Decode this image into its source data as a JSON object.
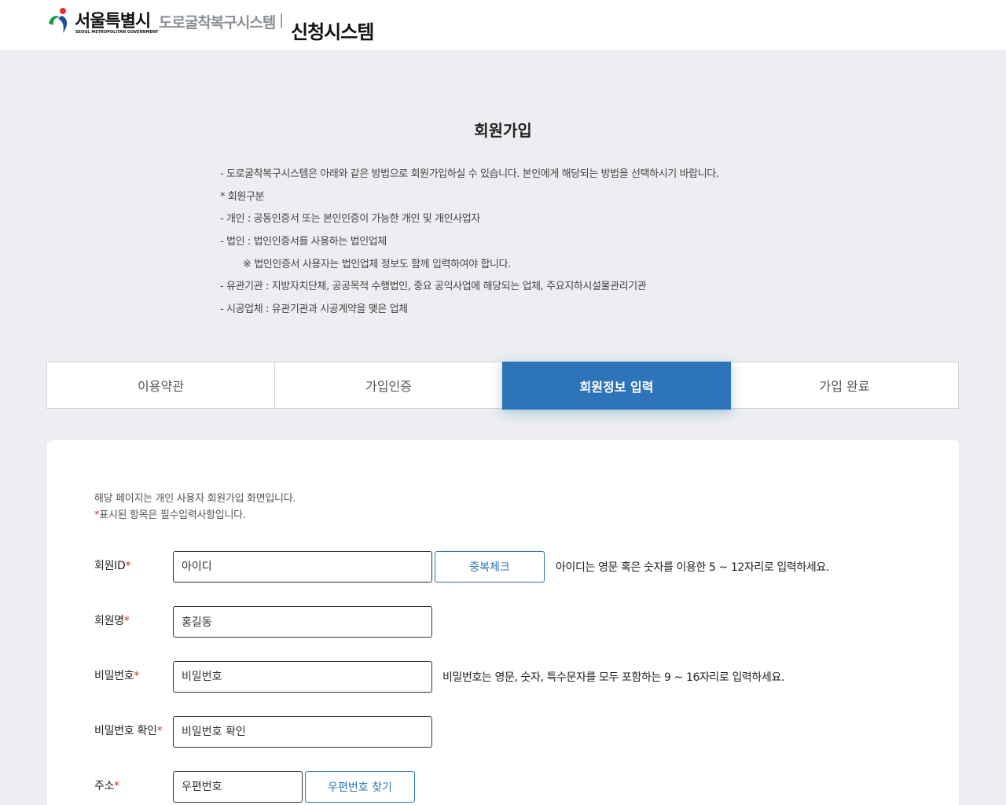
{
  "header": {
    "logo_text": "서울특별시",
    "logo_subtext": "SEOUL METROPOLITAN GOVERNMENT",
    "system_name": "도로굴착복구시스템",
    "separator": "|",
    "app_title": "신청시스템"
  },
  "page": {
    "title": "회원가입",
    "notices": [
      "- 도로굴착복구시스템은 아래와 같은 방법으로 회원가입하실 수 있습니다. 본인에게 해당되는 방법을 선택하시기 바랍니다.",
      "* 회원구분",
      "- 개인 : 공동인증서 또는 본인인증이 가능한 개인 및 개인사업자",
      "- 법인 : 법인인증서를 사용하는 법인업체",
      "※ 법인인증서 사용자는 법인업체 정보도 함께 입력하여야 합니다.",
      "- 유관기관 : 지방자치단체, 공공목적 수행법인, 중요 공익사업에 해당되는 업체, 주요지하시설물관리기관",
      "- 시공업체 : 유관기관과 시공계약을 맺은 업체"
    ]
  },
  "steps": [
    {
      "label": "이용약관"
    },
    {
      "label": "가입인증"
    },
    {
      "label": "회원정보 입력"
    },
    {
      "label": "가입 완료"
    }
  ],
  "form": {
    "guide_line1": "해당 페이지는 개인 사용자 회원가입 화면입니다.",
    "guide_required_mark": "*",
    "guide_line2": "표시된 항목은 필수입력사항입니다.",
    "required_mark": "*",
    "member_id": {
      "label": "회원ID",
      "placeholder": "아이디",
      "check_button": "중복체크",
      "hint": "아이디는 영문 혹은 숫자를 이용한 5 ~ 12자리로 입력하세요."
    },
    "member_name": {
      "label": "회원명",
      "value": "홍길동"
    },
    "password": {
      "label": "비밀번호",
      "placeholder": "비밀번호",
      "hint": "비밀번호는 영문, 숫자, 특수문자를 모두 포함하는 9 ~ 16자리로 입력하세요."
    },
    "password_confirm": {
      "label": "비밀번호 확인",
      "placeholder": "비밀번호 확인"
    },
    "address": {
      "label": "주소",
      "placeholder": "우편번호",
      "search_button": "우편번호 찾기"
    }
  },
  "colors": {
    "accent": "#2e74b8",
    "required": "#c0392b",
    "background": "#eceef1"
  }
}
